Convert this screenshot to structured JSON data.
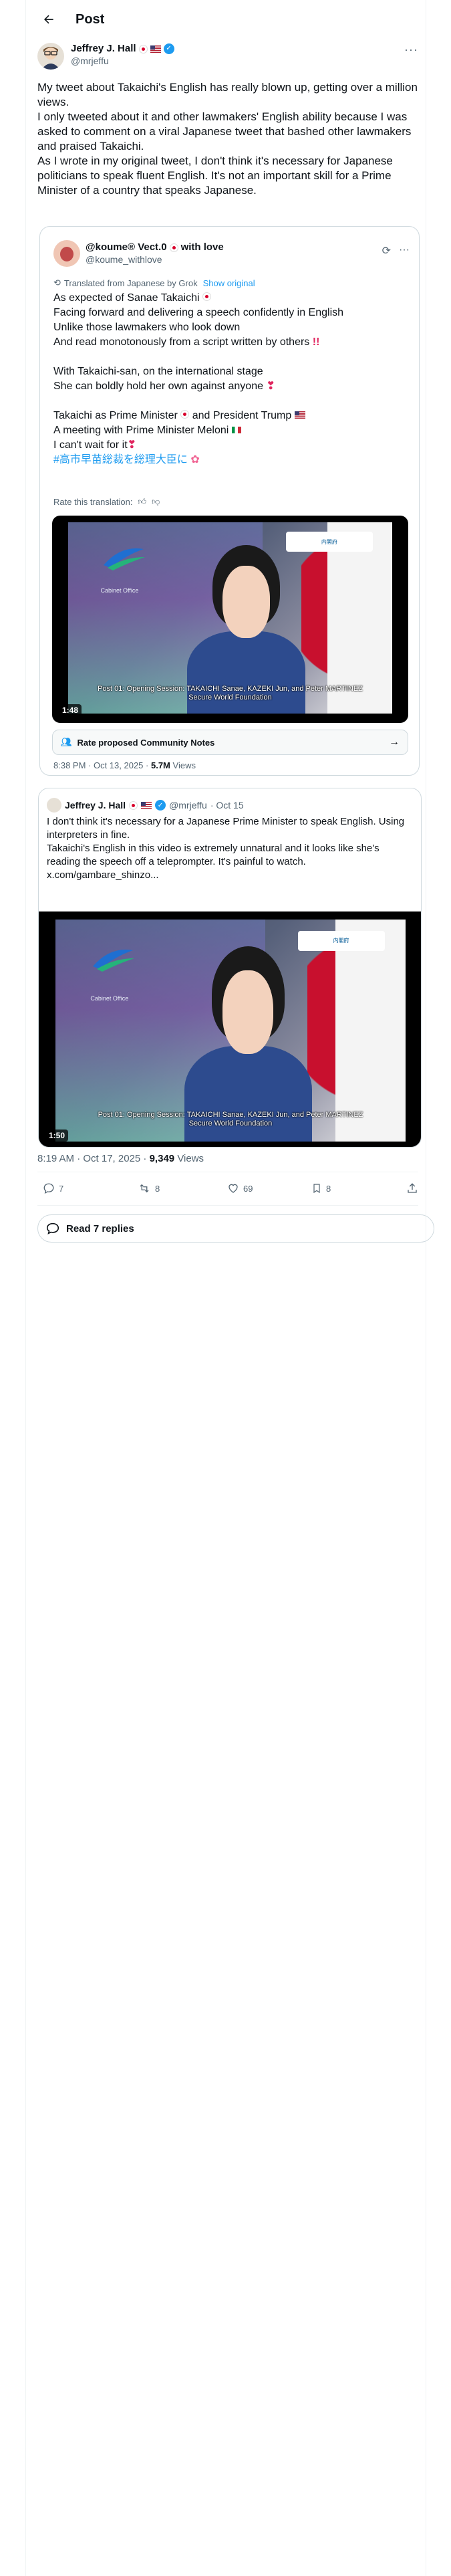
{
  "header": {
    "title": "Post"
  },
  "author": {
    "name": "Jeffrey J. Hall",
    "handle": "@mrjeffu"
  },
  "post": {
    "paragraphs": [
      "My tweet about Takaichi's English has really blown up, getting over a million views.",
      "I only tweeted about it and other lawmakers' English ability because I was asked to comment on a viral Japanese tweet that bashed other lawmakers and praised Takaichi.",
      "As I wrote in my original tweet, I don't think it's necessary for Japanese politicians to speak fluent English. It's not an important skill for a Prime Minister of a country that speaks Japanese."
    ]
  },
  "quote": {
    "name": "@koume® Vect.0",
    "name_suffix": "with love",
    "handle": "@koume_withlove",
    "translated_label": "Translated from Japanese by Grok",
    "show_original": "Show original",
    "lines": [
      "As expected of Sanae Takaichi",
      "Facing forward and delivering a speech confidently in English",
      "Unlike those lawmakers who look down",
      "And read monotonously from a script written by others",
      "",
      "With Takaichi-san, on the international stage",
      "She can boldly hold her own against anyone",
      "",
      "Takaichi as Prime Minister",
      "and President Trump",
      "A meeting with Prime Minister Meloni",
      "I can't wait for it",
      "#高市早苗総裁を総理大臣に"
    ],
    "rate_label": "Rate this translation:",
    "video": {
      "duration": "1:48",
      "caption_line1": "Post 01: Opening Session: TAKAICHI Sanae, KAZEKI Jun, and Peter MARTINEZ",
      "caption_line2": "Secure World Foundation",
      "org_label": "Cabinet Office",
      "badge_label": "内閣府"
    },
    "community_notes": "Rate proposed Community Notes",
    "time": "8:38 PM · Oct 13, 2025 ·",
    "views": "5.7M",
    "views_label": "Views"
  },
  "embed": {
    "name": "Jeffrey J. Hall",
    "handle": "@mrjeffu",
    "date": "· Oct 15",
    "lines": [
      "I don't think it's necessary for a Japanese Prime Minister to speak English. Using interpreters in fine.",
      "Takaichi's English in this video is extremely unnatural and it looks like she's reading the speech off a teleprompter. It's painful to watch.",
      "x.com/gambare_shinzo..."
    ],
    "video": {
      "duration": "1:50",
      "caption_line1": "Post 01: Opening Session: TAKAICHI Sanae, KAZEKI Jun, and Peter MARTINEZ",
      "caption_line2": "Secure World Foundation",
      "org_label": "Cabinet Office",
      "badge_label": "内閣府"
    }
  },
  "meta": {
    "time": "8:19 AM · Oct 17, 2025 ·",
    "views": "9,349",
    "views_label": "Views"
  },
  "actions": {
    "replies": "7",
    "reposts": "8",
    "likes": "69",
    "bookmarks": "8"
  },
  "read_replies": "Read 7 replies"
}
